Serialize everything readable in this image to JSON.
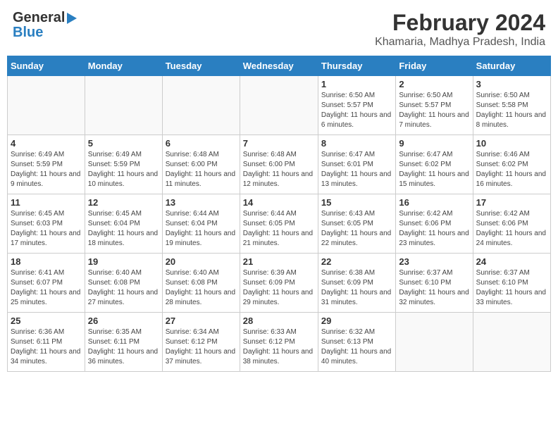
{
  "header": {
    "logo_general": "General",
    "logo_blue": "Blue",
    "month_year": "February 2024",
    "location": "Khamaria, Madhya Pradesh, India"
  },
  "days_of_week": [
    "Sunday",
    "Monday",
    "Tuesday",
    "Wednesday",
    "Thursday",
    "Friday",
    "Saturday"
  ],
  "weeks": [
    [
      {
        "day": "",
        "info": ""
      },
      {
        "day": "",
        "info": ""
      },
      {
        "day": "",
        "info": ""
      },
      {
        "day": "",
        "info": ""
      },
      {
        "day": "1",
        "info": "Sunrise: 6:50 AM\nSunset: 5:57 PM\nDaylight: 11 hours and 6 minutes."
      },
      {
        "day": "2",
        "info": "Sunrise: 6:50 AM\nSunset: 5:57 PM\nDaylight: 11 hours and 7 minutes."
      },
      {
        "day": "3",
        "info": "Sunrise: 6:50 AM\nSunset: 5:58 PM\nDaylight: 11 hours and 8 minutes."
      }
    ],
    [
      {
        "day": "4",
        "info": "Sunrise: 6:49 AM\nSunset: 5:59 PM\nDaylight: 11 hours and 9 minutes."
      },
      {
        "day": "5",
        "info": "Sunrise: 6:49 AM\nSunset: 5:59 PM\nDaylight: 11 hours and 10 minutes."
      },
      {
        "day": "6",
        "info": "Sunrise: 6:48 AM\nSunset: 6:00 PM\nDaylight: 11 hours and 11 minutes."
      },
      {
        "day": "7",
        "info": "Sunrise: 6:48 AM\nSunset: 6:00 PM\nDaylight: 11 hours and 12 minutes."
      },
      {
        "day": "8",
        "info": "Sunrise: 6:47 AM\nSunset: 6:01 PM\nDaylight: 11 hours and 13 minutes."
      },
      {
        "day": "9",
        "info": "Sunrise: 6:47 AM\nSunset: 6:02 PM\nDaylight: 11 hours and 15 minutes."
      },
      {
        "day": "10",
        "info": "Sunrise: 6:46 AM\nSunset: 6:02 PM\nDaylight: 11 hours and 16 minutes."
      }
    ],
    [
      {
        "day": "11",
        "info": "Sunrise: 6:45 AM\nSunset: 6:03 PM\nDaylight: 11 hours and 17 minutes."
      },
      {
        "day": "12",
        "info": "Sunrise: 6:45 AM\nSunset: 6:04 PM\nDaylight: 11 hours and 18 minutes."
      },
      {
        "day": "13",
        "info": "Sunrise: 6:44 AM\nSunset: 6:04 PM\nDaylight: 11 hours and 19 minutes."
      },
      {
        "day": "14",
        "info": "Sunrise: 6:44 AM\nSunset: 6:05 PM\nDaylight: 11 hours and 21 minutes."
      },
      {
        "day": "15",
        "info": "Sunrise: 6:43 AM\nSunset: 6:05 PM\nDaylight: 11 hours and 22 minutes."
      },
      {
        "day": "16",
        "info": "Sunrise: 6:42 AM\nSunset: 6:06 PM\nDaylight: 11 hours and 23 minutes."
      },
      {
        "day": "17",
        "info": "Sunrise: 6:42 AM\nSunset: 6:06 PM\nDaylight: 11 hours and 24 minutes."
      }
    ],
    [
      {
        "day": "18",
        "info": "Sunrise: 6:41 AM\nSunset: 6:07 PM\nDaylight: 11 hours and 25 minutes."
      },
      {
        "day": "19",
        "info": "Sunrise: 6:40 AM\nSunset: 6:08 PM\nDaylight: 11 hours and 27 minutes."
      },
      {
        "day": "20",
        "info": "Sunrise: 6:40 AM\nSunset: 6:08 PM\nDaylight: 11 hours and 28 minutes."
      },
      {
        "day": "21",
        "info": "Sunrise: 6:39 AM\nSunset: 6:09 PM\nDaylight: 11 hours and 29 minutes."
      },
      {
        "day": "22",
        "info": "Sunrise: 6:38 AM\nSunset: 6:09 PM\nDaylight: 11 hours and 31 minutes."
      },
      {
        "day": "23",
        "info": "Sunrise: 6:37 AM\nSunset: 6:10 PM\nDaylight: 11 hours and 32 minutes."
      },
      {
        "day": "24",
        "info": "Sunrise: 6:37 AM\nSunset: 6:10 PM\nDaylight: 11 hours and 33 minutes."
      }
    ],
    [
      {
        "day": "25",
        "info": "Sunrise: 6:36 AM\nSunset: 6:11 PM\nDaylight: 11 hours and 34 minutes."
      },
      {
        "day": "26",
        "info": "Sunrise: 6:35 AM\nSunset: 6:11 PM\nDaylight: 11 hours and 36 minutes."
      },
      {
        "day": "27",
        "info": "Sunrise: 6:34 AM\nSunset: 6:12 PM\nDaylight: 11 hours and 37 minutes."
      },
      {
        "day": "28",
        "info": "Sunrise: 6:33 AM\nSunset: 6:12 PM\nDaylight: 11 hours and 38 minutes."
      },
      {
        "day": "29",
        "info": "Sunrise: 6:32 AM\nSunset: 6:13 PM\nDaylight: 11 hours and 40 minutes."
      },
      {
        "day": "",
        "info": ""
      },
      {
        "day": "",
        "info": ""
      }
    ]
  ]
}
